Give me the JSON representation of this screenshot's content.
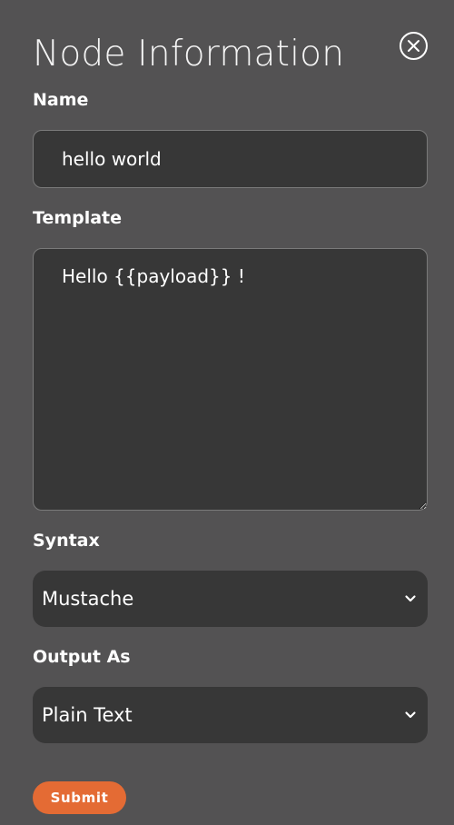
{
  "panel": {
    "title": "Node Information",
    "close_icon": "close-circle-icon"
  },
  "form": {
    "name": {
      "label": "Name",
      "value": "hello world"
    },
    "template": {
      "label": "Template",
      "value": "Hello {{payload}} !"
    },
    "syntax": {
      "label": "Syntax",
      "selected": "Mustache",
      "icon": "chevron-down-icon"
    },
    "output_as": {
      "label": "Output As",
      "selected": "Plain Text",
      "icon": "chevron-down-icon"
    },
    "submit_label": "Submit"
  },
  "colors": {
    "background": "#535253",
    "field_background": "#373737",
    "submit_button": "#e46b34",
    "text": "#ffffff"
  }
}
